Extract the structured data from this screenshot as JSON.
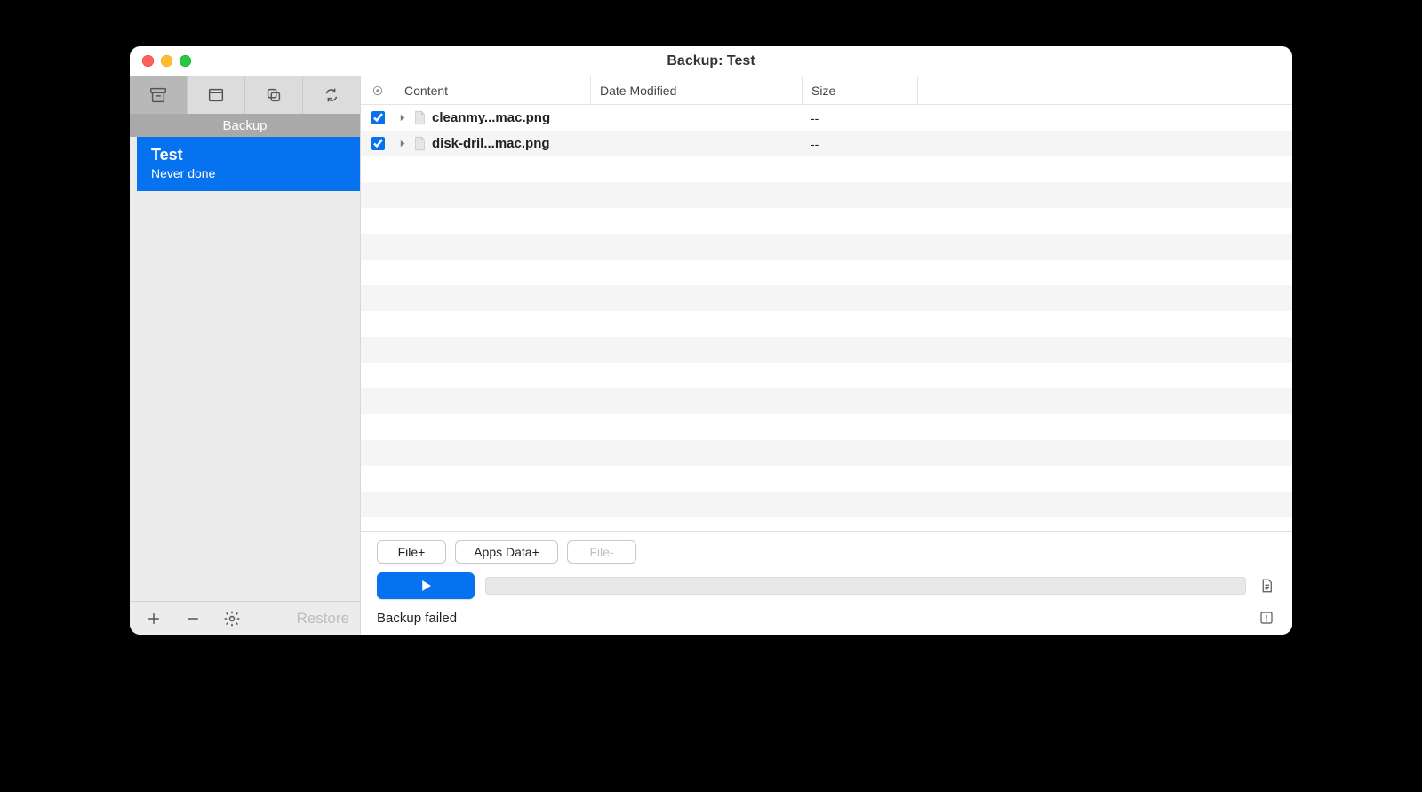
{
  "title": "Backup: Test",
  "sidebar": {
    "heading": "Backup",
    "items": [
      {
        "name": "Test",
        "subtitle": "Never done",
        "selected": true
      }
    ],
    "footer": {
      "restore_label": "Restore"
    }
  },
  "columns": {
    "content": "Content",
    "date": "Date Modified",
    "size": "Size"
  },
  "rows": [
    {
      "checked": true,
      "name": "cleanmy...mac.png",
      "date": "",
      "size": "--"
    },
    {
      "checked": true,
      "name": "disk-dril...mac.png",
      "date": "",
      "size": "--"
    }
  ],
  "bottom": {
    "file_add": "File+",
    "apps_data": "Apps Data+",
    "file_remove": "File-",
    "status": "Backup failed"
  }
}
